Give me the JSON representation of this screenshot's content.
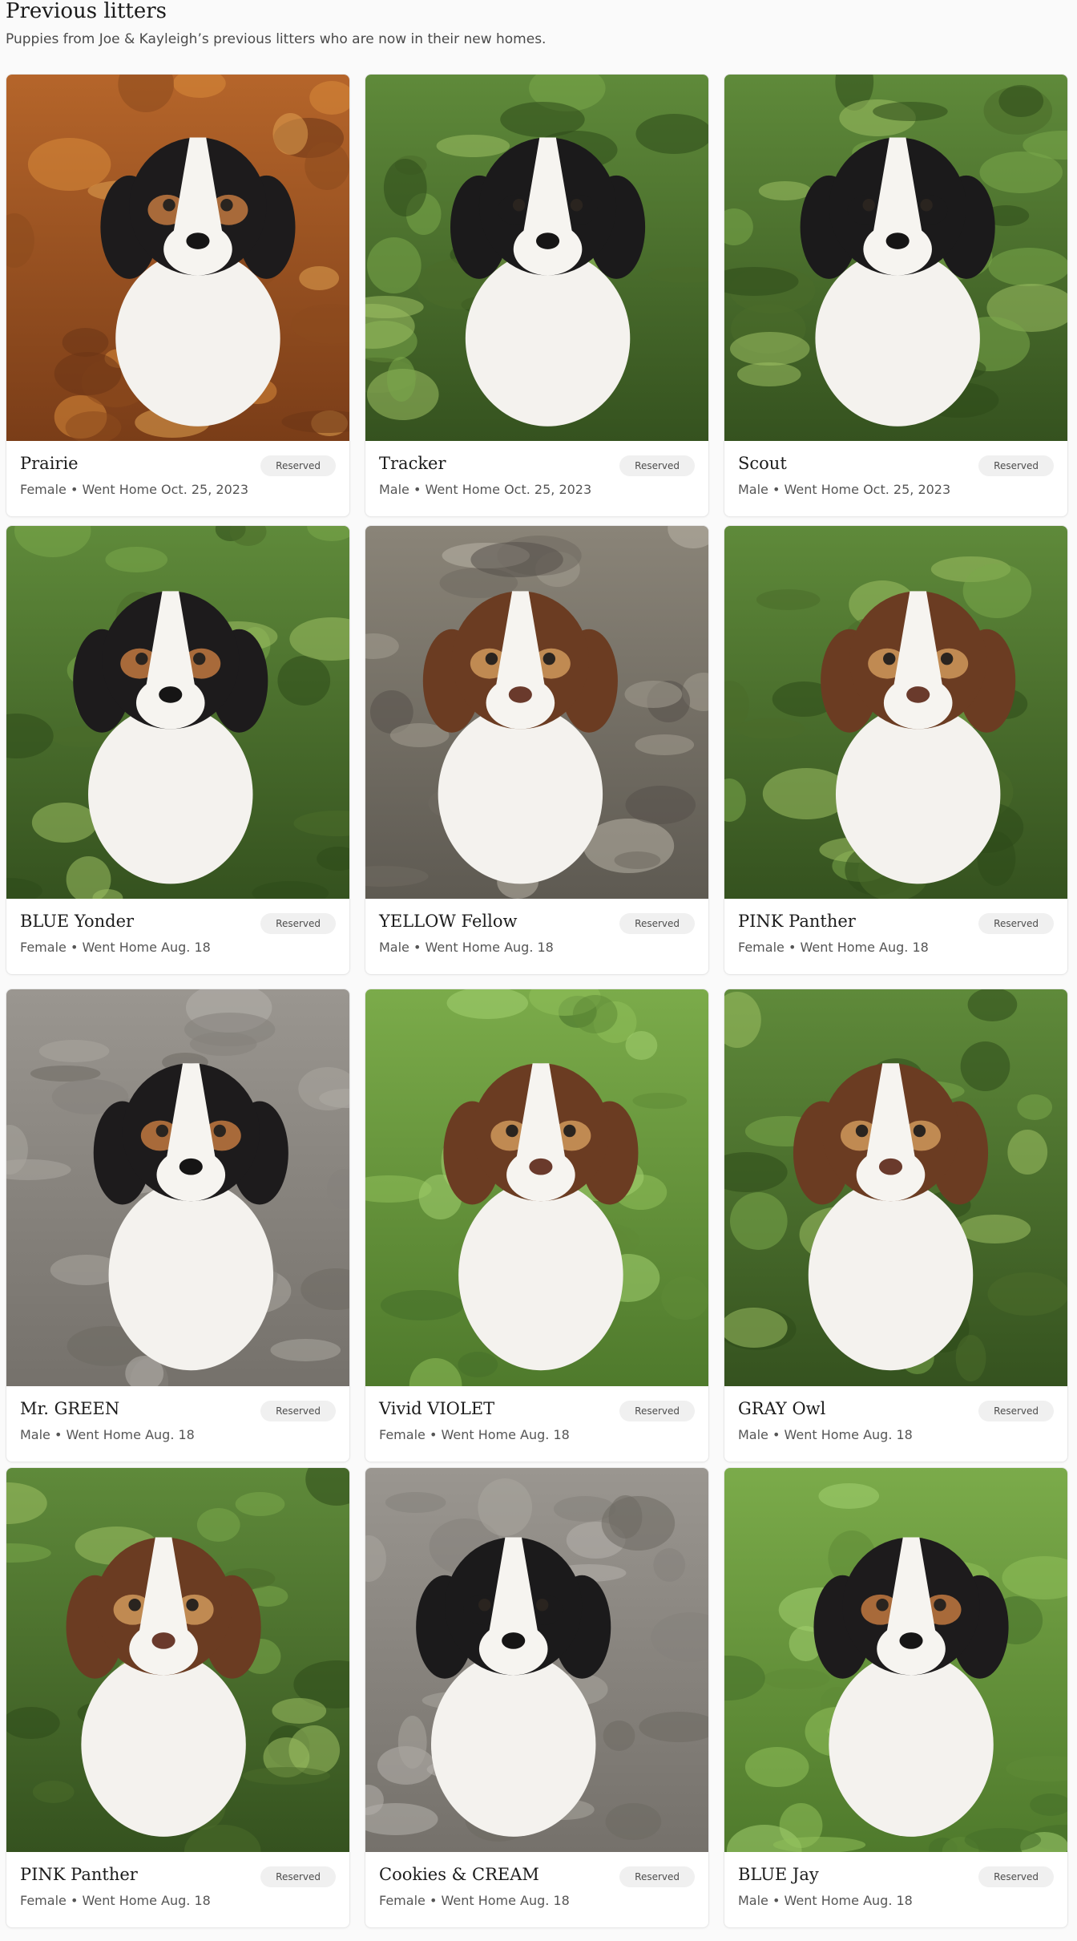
{
  "header": {
    "title": "Previous litters",
    "subtitle": "Puppies from Joe & Kayleigh’s previous litters who are now in their new homes."
  },
  "colors": {
    "page_background": "#fafafa",
    "badge_background": "#f0f0f0",
    "badge_text": "#4d4d4d"
  },
  "puppies": [
    {
      "name": "Prairie",
      "meta": "Female • Went Home Oct. 25, 2023",
      "status": "Reserved",
      "coat": "black-tri",
      "scene": "autumn-leaves"
    },
    {
      "name": "Tracker",
      "meta": "Male • Went Home Oct. 25, 2023",
      "status": "Reserved",
      "coat": "black-white",
      "scene": "green-grass"
    },
    {
      "name": "Scout",
      "meta": "Male • Went Home Oct. 25, 2023",
      "status": "Reserved",
      "coat": "black-white",
      "scene": "green-grass"
    },
    {
      "name": "BLUE Yonder",
      "meta": "Female • Went Home Aug. 18",
      "status": "Reserved",
      "coat": "black-tri",
      "scene": "green-grass"
    },
    {
      "name": "YELLOW Fellow",
      "meta": "Male • Went Home Aug. 18",
      "status": "Reserved",
      "coat": "red-tri",
      "scene": "gray-stone"
    },
    {
      "name": "PINK Panther",
      "meta": "Female • Went Home Aug. 18",
      "status": "Reserved",
      "coat": "red-tri",
      "scene": "green-grass"
    },
    {
      "name": "Mr. GREEN",
      "meta": "Male • Went Home Aug. 18",
      "status": "Reserved",
      "coat": "black-tri",
      "scene": "concrete"
    },
    {
      "name": "Vivid VIOLET",
      "meta": "Female • Went Home Aug. 18",
      "status": "Reserved",
      "coat": "red-tri",
      "scene": "green-blur"
    },
    {
      "name": "GRAY Owl",
      "meta": "Male • Went Home Aug. 18",
      "status": "Reserved",
      "coat": "red-tri",
      "scene": "green-grass"
    },
    {
      "name": "PINK Panther",
      "meta": "Female • Went Home Aug. 18",
      "status": "Reserved",
      "coat": "red-tri",
      "scene": "green-grass"
    },
    {
      "name": "Cookies & CREAM",
      "meta": "Female • Went Home Aug. 18",
      "status": "Reserved",
      "coat": "black-white",
      "scene": "concrete"
    },
    {
      "name": "BLUE Jay",
      "meta": "Male • Went Home Aug. 18",
      "status": "Reserved",
      "coat": "black-tri",
      "scene": "green-blur"
    }
  ]
}
